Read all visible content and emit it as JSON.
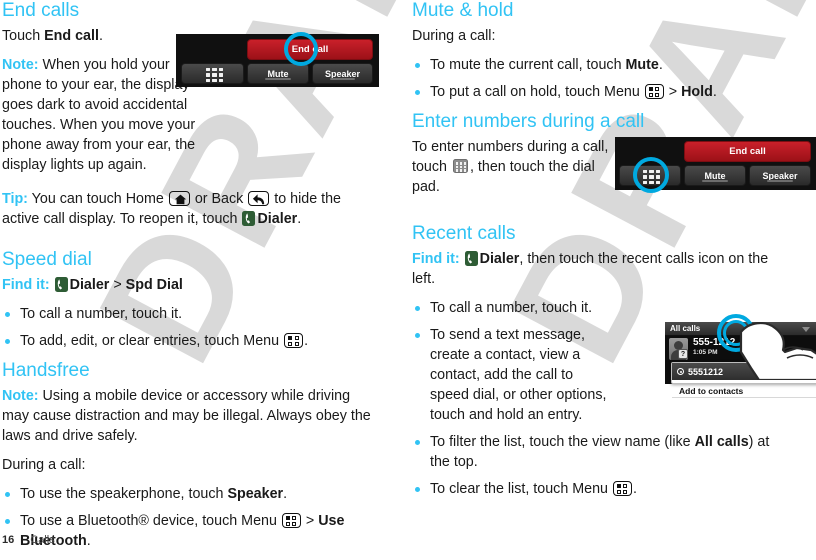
{
  "document": {
    "footer": {
      "page_number": "16",
      "chapter": "Calls"
    },
    "watermark": "DRAFT"
  },
  "left_column": {
    "section1": {
      "heading": "End calls",
      "p1_a": "Touch ",
      "p1_b": "End call",
      "p1_c": ".",
      "note_label": "Note:",
      "note_text": " When you hold your phone to your ear, the display goes dark to avoid accidental touches. When you move your phone away from your ear, the display lights up again.",
      "tip_label": "Tip:",
      "tip_t1": " You can touch Home ",
      "tip_t2": " or Back ",
      "tip_t3": " to hide the active call display. To reopen it, touch ",
      "tip_t4": "Dialer",
      "tip_t5": "."
    },
    "section2": {
      "heading": "Speed dial",
      "find_label": "Find it:",
      "find_a": "Dialer",
      "find_sep": " > ",
      "find_b": "Spd Dial",
      "bullets": [
        {
          "t1": "To call a number, touch it."
        },
        {
          "t1": "To add, edit, or clear entries, touch Menu ",
          "t2": "."
        }
      ]
    },
    "section3": {
      "heading": "Handsfree",
      "note_label": "Note:",
      "note_text": " Using a mobile device or accessory while driving may cause distraction and may be illegal. Always obey the laws and drive safely.",
      "during": "During a call:",
      "bullets": [
        {
          "t1": "To use the speakerphone, touch ",
          "b1": "Speaker",
          "t2": "."
        },
        {
          "t1": "To use a Bluetooth® device, touch Menu ",
          "t2": " > ",
          "b1": "Use Bluetooth",
          "t3": "."
        }
      ]
    }
  },
  "right_column": {
    "section1": {
      "heading": "Mute & hold",
      "during": "During a call:",
      "bullets": [
        {
          "t1": "To mute the current call, touch ",
          "b1": "Mute",
          "t2": "."
        },
        {
          "t1": "To put a call on hold, touch Menu ",
          "t2": " > ",
          "b1": "Hold",
          "t3": "."
        }
      ]
    },
    "section2": {
      "heading": "Enter numbers during a call",
      "p1_a": "To enter numbers during a call, touch ",
      "p1_b": ", then touch the dial pad."
    },
    "section3": {
      "heading": "Recent calls",
      "find_label": "Find it:",
      "find_a": "Dialer",
      "find_rest": ", then touch the recent calls icon on the left.",
      "bullets": [
        {
          "t1": "To call a number, touch it."
        },
        {
          "t1": "To send a text message, create a contact, view a contact, add the call to speed dial, or other options, touch and hold an entry."
        },
        {
          "t1": "To filter the list, touch the view name (like ",
          "b1": "All calls",
          "t2": ") at the top."
        },
        {
          "t1": "To clear the list, touch Menu ",
          "t2": "."
        }
      ]
    }
  },
  "screenshots": {
    "call_controls_1": {
      "end_call": "End call",
      "mute": "Mute",
      "speaker": "Speaker",
      "keypad_icon": "dialpad-icon",
      "highlight_target": "End call"
    },
    "call_controls_2": {
      "end_call": "End call",
      "mute": "Mute",
      "speaker": "Speaker",
      "keypad_icon": "dialpad-icon",
      "highlight_target": "dial pad"
    },
    "recent_calls": {
      "view_name": "All calls",
      "entry_number": "555-1212",
      "entry_time": "1:05 PM",
      "popup_title": "5551212",
      "popup_item": "Add to contacts"
    }
  },
  "colors": {
    "heading": "#31c3f4",
    "accent": "#31c3f4",
    "end_call_button": "#c9202a",
    "highlight_ring": "#00a9e0",
    "dialer_icon": "#2e5c35"
  }
}
